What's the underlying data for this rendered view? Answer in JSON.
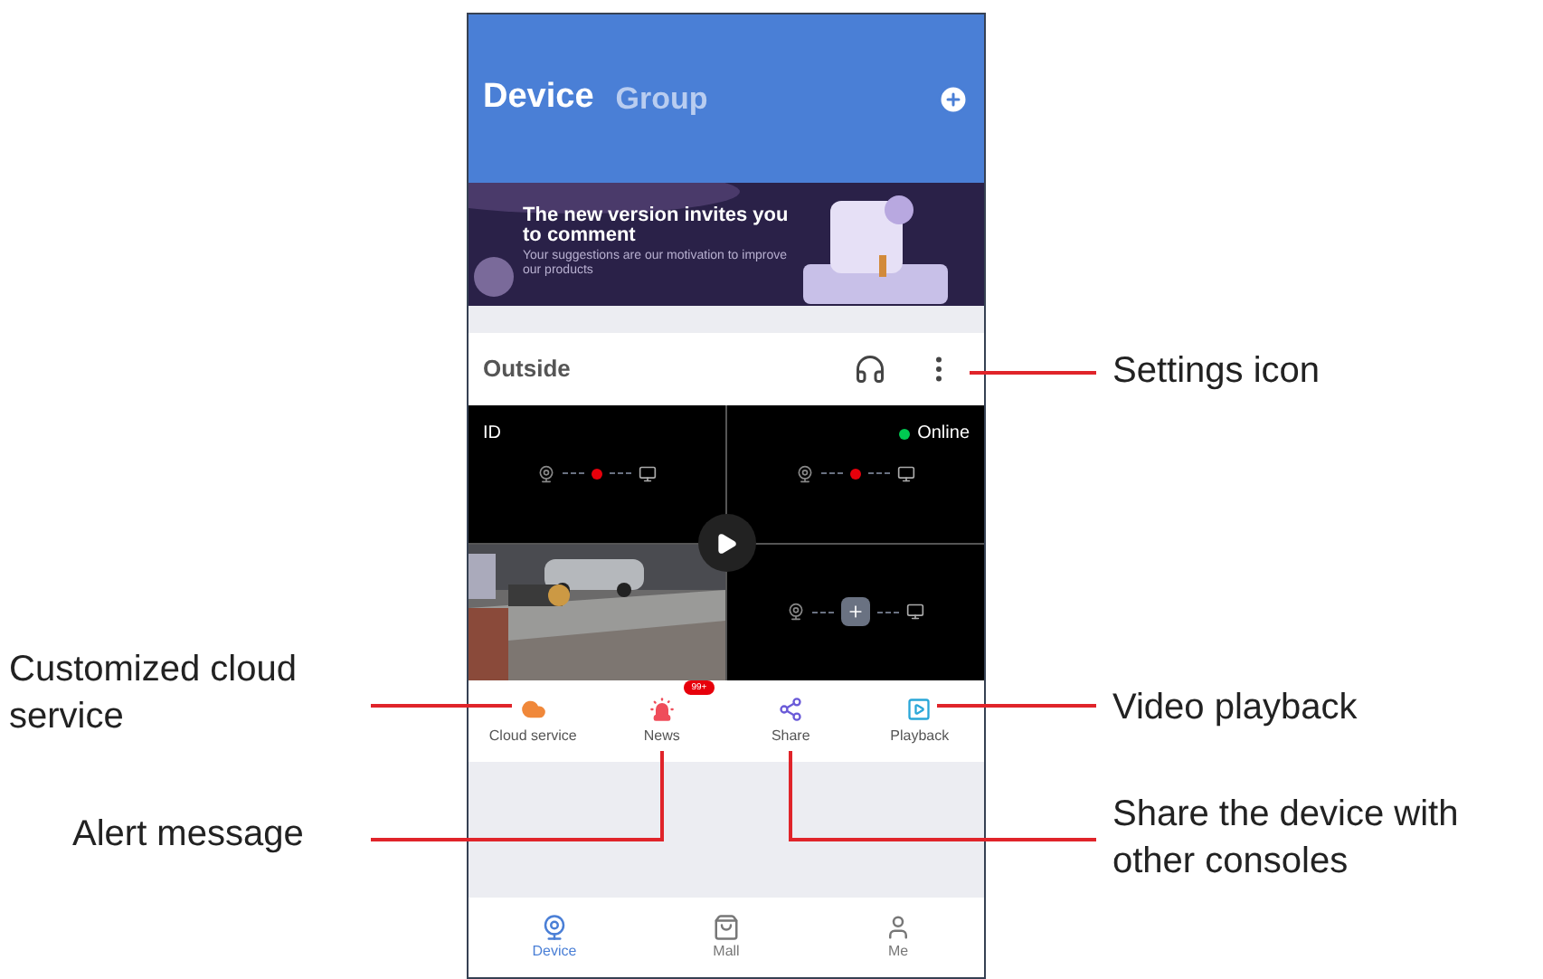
{
  "header": {
    "tabs": [
      {
        "label": "Device",
        "selected": true
      },
      {
        "label": "Group",
        "selected": false
      }
    ]
  },
  "banner": {
    "title": "The new version invites you to comment",
    "subtitle": "Your suggestions are our motivation to improve our products"
  },
  "device": {
    "name": "Outside",
    "id_label": "ID",
    "status": "Online",
    "channels": [
      {
        "kind": "offline"
      },
      {
        "kind": "offline"
      },
      {
        "kind": "picture"
      },
      {
        "kind": "add"
      }
    ]
  },
  "actions": [
    {
      "kind": "cloud",
      "label": "Cloud service"
    },
    {
      "kind": "news",
      "label": "News",
      "badge": "99+"
    },
    {
      "kind": "share",
      "label": "Share"
    },
    {
      "kind": "playback",
      "label": "Playback"
    }
  ],
  "nav": [
    {
      "kind": "device",
      "label": "Device",
      "selected": true
    },
    {
      "kind": "mall",
      "label": "Mall",
      "selected": false
    },
    {
      "kind": "me",
      "label": "Me",
      "selected": false
    }
  ],
  "callouts": [
    {
      "text": "Settings icon"
    },
    {
      "text": "Customized cloud service"
    },
    {
      "text": "Video playback"
    },
    {
      "text": "Alert message"
    },
    {
      "text": "Share the device with other consoles"
    }
  ]
}
